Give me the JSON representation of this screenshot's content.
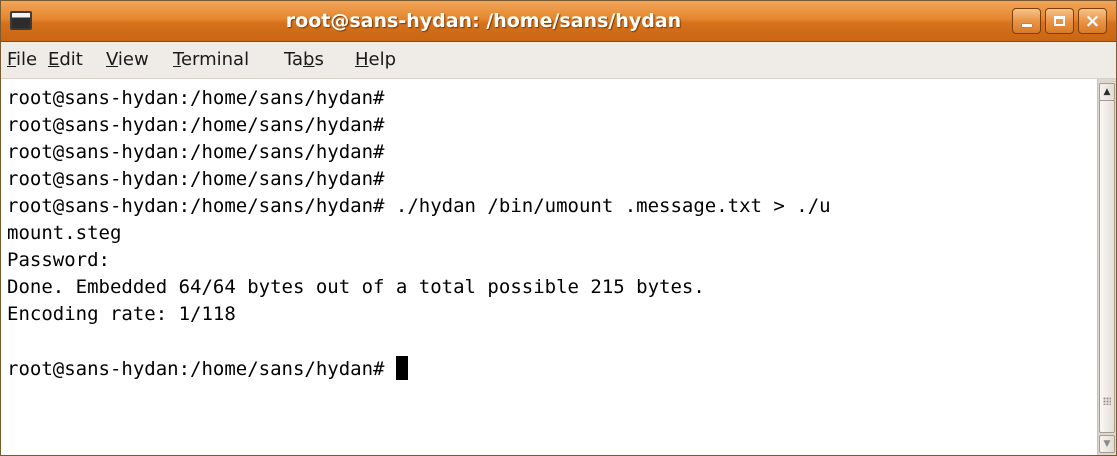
{
  "window": {
    "title": "root@sans-hydan: /home/sans/hydan",
    "controls": {
      "minimize_icon": "minimize-icon",
      "maximize_icon": "maximize-icon",
      "close_glyph": "×"
    },
    "accent_color": "#e4862e"
  },
  "menubar": {
    "items": [
      {
        "before": "",
        "underline": "F",
        "after": "ile"
      },
      {
        "before": "",
        "underline": "E",
        "after": "dit"
      },
      {
        "before": "",
        "underline": "V",
        "after": "iew"
      },
      {
        "before": "",
        "underline": "T",
        "after": "erminal"
      },
      {
        "before": "Ta",
        "underline": "b",
        "after": "s"
      },
      {
        "before": "",
        "underline": "H",
        "after": "elp"
      }
    ]
  },
  "terminal": {
    "lines": [
      "root@sans-hydan:/home/sans/hydan#",
      "root@sans-hydan:/home/sans/hydan#",
      "root@sans-hydan:/home/sans/hydan#",
      "root@sans-hydan:/home/sans/hydan#",
      "root@sans-hydan:/home/sans/hydan# ./hydan /bin/umount .message.txt > ./u",
      "mount.steg",
      "Password:",
      "Done. Embedded 64/64 bytes out of a total possible 215 bytes.",
      "Encoding rate: 1/118",
      "",
      "root@sans-hydan:/home/sans/hydan# "
    ]
  },
  "scrollbar": {
    "up_arrow": "▲",
    "down_arrow": "▼"
  }
}
